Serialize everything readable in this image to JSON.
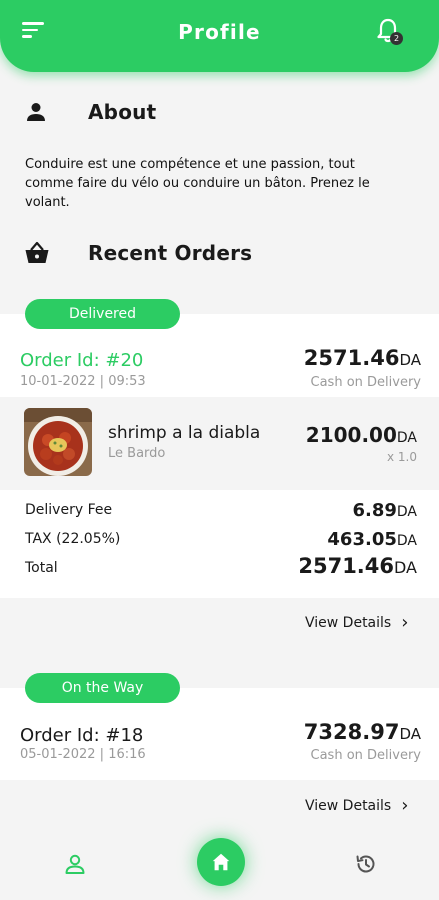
{
  "header": {
    "title": "Profile",
    "notification_count": "2"
  },
  "about": {
    "heading": "About",
    "text": "Conduire est une compétence et une passion, tout comme faire du vélo ou conduire un bâton. Prenez le volant."
  },
  "recent_orders": {
    "heading": "Recent Orders",
    "orders": [
      {
        "status": "Delivered",
        "order_id": "Order Id: #20",
        "date": "10-01-2022 | 09:53",
        "amount": "2571.46",
        "currency": "DA",
        "payment_method": "Cash on Delivery",
        "items": [
          {
            "name": "shrimp a la diabla",
            "restaurant": "Le Bardo",
            "price": "2100.00",
            "currency": "DA",
            "quantity": "x 1.0"
          }
        ],
        "fees": {
          "delivery_label": "Delivery Fee",
          "delivery_value": "6.89",
          "tax_label": "TAX (22.05%)",
          "tax_value": "463.05",
          "total_label": "Total",
          "total_value": "2571.46",
          "currency": "DA"
        },
        "view_details": "View Details"
      },
      {
        "status": "On the Way",
        "order_id": "Order Id: #18",
        "date": "05-01-2022 | 16:16",
        "amount": "7328.97",
        "currency": "DA",
        "payment_method": "Cash on Delivery",
        "view_details": "View Details"
      }
    ]
  },
  "colors": {
    "accent": "#2ccc63",
    "text": "#1a1a1a",
    "muted": "#9a9a9a",
    "background": "#f4f4f4"
  },
  "icons": {
    "menu": "menu-icon",
    "notifications": "bell-icon",
    "about": "user-icon",
    "orders": "basket-icon",
    "nav_profile": "user-outline-icon",
    "nav_home": "home-icon",
    "nav_history": "history-icon"
  }
}
